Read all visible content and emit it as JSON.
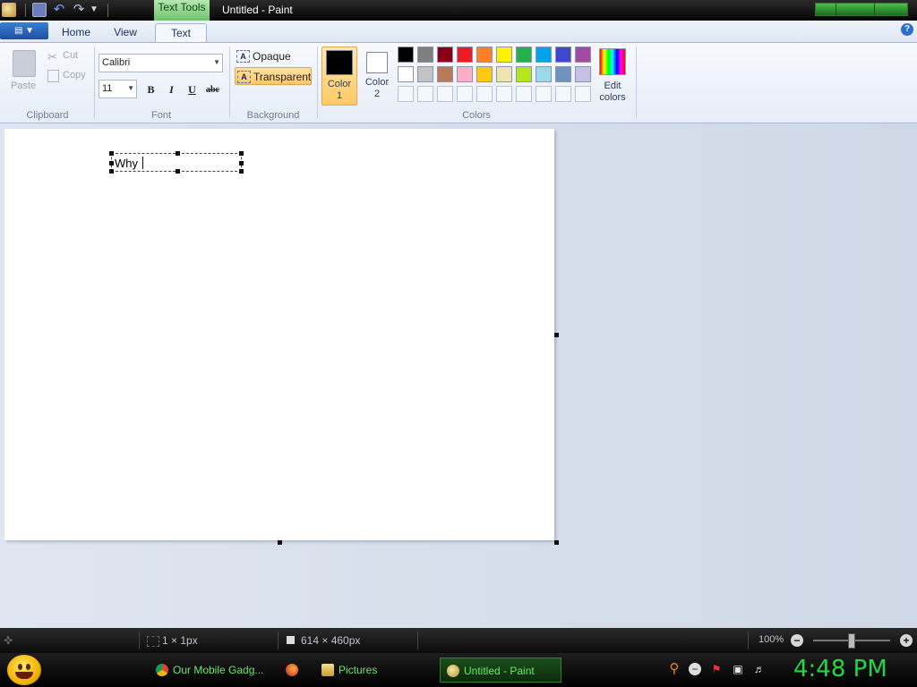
{
  "window": {
    "title": "Untitled - Paint",
    "context_tab": "Text Tools"
  },
  "tabs": {
    "home": "Home",
    "view": "View",
    "text": "Text"
  },
  "clipboard": {
    "paste": "Paste",
    "cut": "Cut",
    "copy": "Copy",
    "group": "Clipboard"
  },
  "font": {
    "family": "Calibri",
    "size": "11",
    "bold": "B",
    "italic": "I",
    "underline": "U",
    "strike": "abc",
    "group": "Font"
  },
  "background": {
    "opaque": "Opaque",
    "transparent": "Transparent",
    "group": "Background",
    "selected": "Transparent"
  },
  "colors": {
    "color1_label": "Color 1",
    "color1_value": "#000000",
    "color2_label": "Color 2",
    "color2_value": "#ffffff",
    "edit_label": "Edit colors",
    "group": "Colors",
    "palette_row1": [
      "#000000",
      "#7f7f7f",
      "#880015",
      "#ed1c24",
      "#ff7f27",
      "#fff200",
      "#22b14c",
      "#00a2e8",
      "#3f48cc",
      "#a349a4"
    ],
    "palette_row2": [
      "#ffffff",
      "#c3c3c3",
      "#b97a57",
      "#ffaec9",
      "#ffc90e",
      "#efe4b0",
      "#b5e61d",
      "#99d9ea",
      "#7092be",
      "#c8bfe7"
    ]
  },
  "canvas": {
    "text": "Why "
  },
  "status": {
    "selection_size": "1 × 1px",
    "canvas_size": "614 × 460px",
    "zoom": "100%"
  },
  "taskbar": {
    "items": [
      "Our Mobile Gadg...",
      "",
      "Pictures",
      "Untitled - Paint"
    ],
    "clock": "4:48 PM"
  }
}
